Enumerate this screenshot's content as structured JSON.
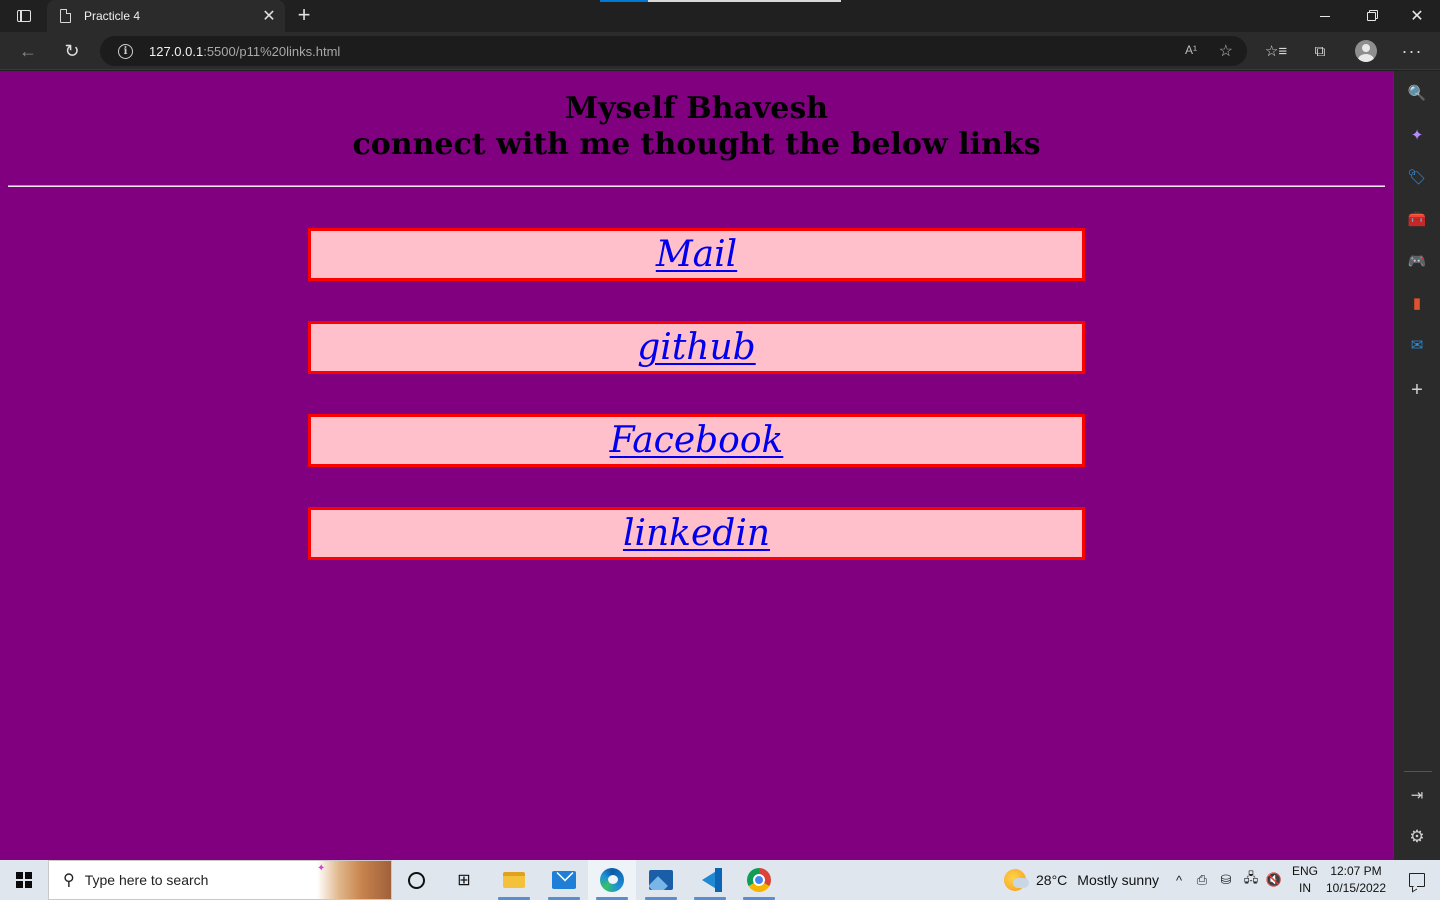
{
  "browser": {
    "tab_title": "Practicle 4",
    "tab_close_glyph": "✕",
    "new_tab_glyph": "+",
    "url_host": "127.0.0.1",
    "url_path": ":5500/p11%20links.html",
    "icons": {
      "tab_actions": "tab-actions-icon",
      "document": "document-icon",
      "back": "back-arrow-icon",
      "reload": "reload-icon",
      "info": "info-icon",
      "read_aloud": "read-aloud-icon",
      "add_favorite": "add-favorite-icon",
      "favorites": "favorites-icon",
      "collections": "collections-icon",
      "profile": "profile-icon",
      "more": "more-icon"
    },
    "glyphs": {
      "back": "←",
      "reload": "↻",
      "info": "i",
      "read_aloud": "A¹",
      "add_favorite": "☆",
      "favorites": "☆≡",
      "collections": "⧉",
      "more": "···",
      "close": "✕"
    }
  },
  "page": {
    "heading_line1": "Myself Bhavesh",
    "heading_line2": "connect with me thought the below links",
    "background_color": "#800080",
    "box_background": "#ffc0cb",
    "box_border": "#ff0000",
    "link_color": "#0000ee",
    "links": [
      {
        "label": "Mail"
      },
      {
        "label": "github"
      },
      {
        "label": "Facebook"
      },
      {
        "label": "linkedin"
      }
    ]
  },
  "sidebar": {
    "items": [
      {
        "icon": "search-icon",
        "glyph": "🔍"
      },
      {
        "icon": "copilot-icon",
        "glyph": "✦"
      },
      {
        "icon": "shopping-tag-icon",
        "glyph": "🏷"
      },
      {
        "icon": "tools-icon",
        "glyph": "🧰"
      },
      {
        "icon": "games-icon",
        "glyph": "🎮"
      },
      {
        "icon": "office-icon",
        "glyph": "▮"
      },
      {
        "icon": "outlook-icon",
        "glyph": "✉"
      },
      {
        "icon": "add-icon",
        "glyph": "+"
      }
    ],
    "bottom": [
      {
        "icon": "split-screen-icon",
        "glyph": "⇥"
      },
      {
        "icon": "settings-gear-icon",
        "glyph": "⚙"
      }
    ]
  },
  "taskbar": {
    "search_placeholder": "Type here to search",
    "search_glyph": "⚲",
    "taskview_glyph": "⊞",
    "apps": [
      "cortana",
      "task-view",
      "file-explorer",
      "mail",
      "edge",
      "photos",
      "vscode",
      "chrome"
    ],
    "weather_temp": "28°C",
    "weather_desc": "Mostly sunny",
    "tray_glyphs": [
      "^",
      "⎙",
      "⛁",
      "🖧",
      "🔇"
    ],
    "lang_line1": "ENG",
    "lang_line2": "IN",
    "time": "12:07 PM",
    "date": "10/15/2022"
  }
}
